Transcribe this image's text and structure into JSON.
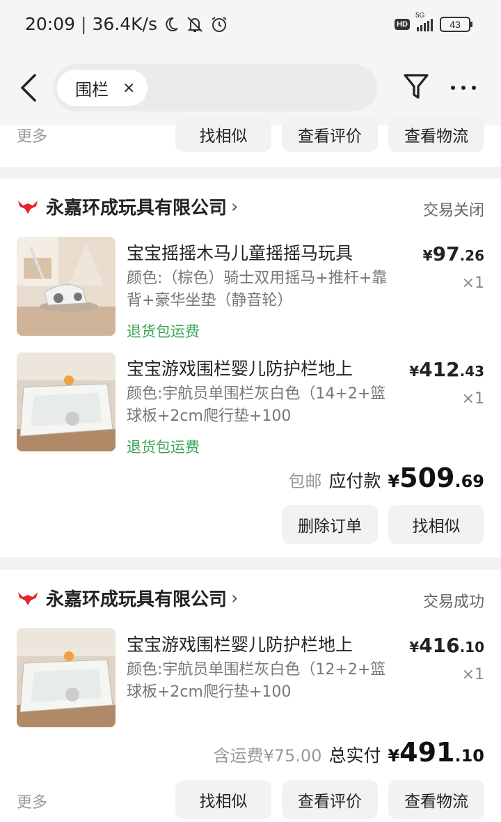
{
  "status_bar": {
    "time": "20:09",
    "speed": "36.4K/s",
    "hd": "HD",
    "network": "5G",
    "battery": "43"
  },
  "header": {
    "search_chip": "围栏",
    "chip_close": "×"
  },
  "prev_card": {
    "more": "更多",
    "buttons": [
      "找相似",
      "查看评价",
      "查看物流"
    ]
  },
  "orders": [
    {
      "shop": "永嘉环成玩具有限公司",
      "status": "交易关闭",
      "items": [
        {
          "title": "宝宝摇摇木马儿童摇摇马玩具",
          "spec": "颜色:（棕色）骑士双用摇马+推杆+靠背+豪华坐垫（静音轮）",
          "return": "退货包运费",
          "price_int": "97",
          "price_dec": ".26",
          "qty": "×1"
        },
        {
          "title": "宝宝游戏围栏婴儿防护栏地上",
          "spec": "颜色:宇航员单围栏灰白色（14+2+篮球板+2cm爬行垫+100",
          "return": "退货包运费",
          "price_int": "412",
          "price_dec": ".43",
          "qty": "×1"
        }
      ],
      "shipping_note": "包邮",
      "total_label": "应付款",
      "total_int": "509",
      "total_dec": ".69",
      "buttons": [
        "删除订单",
        "找相似"
      ]
    },
    {
      "shop": "永嘉环成玩具有限公司",
      "status": "交易成功",
      "items": [
        {
          "title": "宝宝游戏围栏婴儿防护栏地上",
          "spec": "颜色:宇航员单围栏灰白色（12+2+篮球板+2cm爬行垫+100",
          "price_int": "416",
          "price_dec": ".10",
          "qty": "×1"
        }
      ],
      "shipping_note": "含运费¥75.00",
      "total_label": "总实付",
      "total_int": "491",
      "total_dec": ".10",
      "more": "更多",
      "buttons": [
        "找相似",
        "查看评价",
        "查看物流"
      ]
    }
  ],
  "currency": "¥",
  "colors": {
    "accent_red": "#e0262b",
    "return_green": "#3aa655"
  }
}
